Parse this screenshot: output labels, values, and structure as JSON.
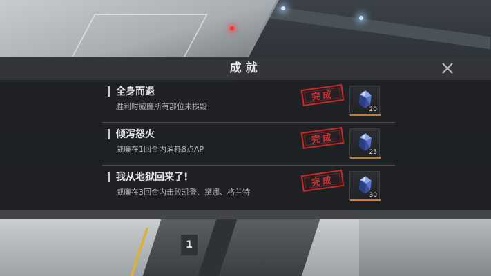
{
  "dialog": {
    "title": "成就",
    "close_icon": "close-icon"
  },
  "achievements": [
    {
      "title": "全身而退",
      "description": "胜利时威廉所有部位未损毁",
      "status": "完成",
      "reward_icon": "crystal-gem-icon",
      "reward_count": "20"
    },
    {
      "title": "倾泻怒火",
      "description": "威廉在1回合内消耗8点AP",
      "status": "完成",
      "reward_icon": "crystal-gem-icon",
      "reward_count": "25"
    },
    {
      "title": "我从地狱回来了!",
      "description": "威廉在3回合内击败凯登、黛娜、格兰特",
      "status": "完成",
      "reward_icon": "crystal-gem-icon",
      "reward_count": "30"
    }
  ],
  "scene": {
    "pad_number": "1"
  },
  "colors": {
    "stamp_red": "#c42a2a",
    "reward_accent": "#d07a2a",
    "panel_bg": "#1e2023",
    "header_bg": "#343639"
  }
}
